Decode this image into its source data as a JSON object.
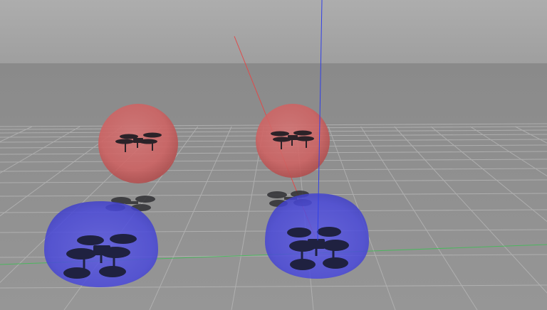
{
  "scene": {
    "sky_color": "#a7a7a7",
    "ground_color": "#8d8d8d",
    "grid_color": "#b8b8b8",
    "x_axis_color": "#e04a4a",
    "y_axis_color": "#3bbf52",
    "z_axis_color": "#3240e6",
    "red_bubble_color": "#d65a5a",
    "blue_bubble_color": "#4848e8",
    "drone_color": "#241f28",
    "shadow_color": "#2f2f33",
    "icons": {
      "drone": "quadcopter-drone-icon",
      "shadow": "drone-shadow-icon",
      "red_bubble": "red-collision-sphere",
      "blue_bubble": "blue-collision-hemisphere"
    }
  }
}
